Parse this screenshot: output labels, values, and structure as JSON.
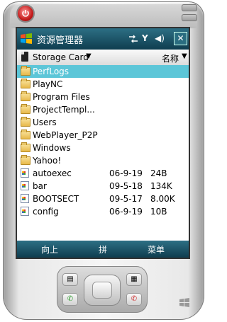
{
  "titlebar": {
    "app_title": "资源管理器",
    "close_label": "✕",
    "signal_label": "Y",
    "volume_label": "◀)"
  },
  "location": {
    "storage": "Storage Card",
    "sort": "名称"
  },
  "files": [
    {
      "name": "PerfLogs",
      "type": "folder",
      "date": "",
      "size": "",
      "selected": true
    },
    {
      "name": "PlayNC",
      "type": "folder",
      "date": "",
      "size": ""
    },
    {
      "name": "Program Files",
      "type": "folder",
      "date": "",
      "size": ""
    },
    {
      "name": "ProjectTempl...",
      "type": "folder",
      "date": "",
      "size": ""
    },
    {
      "name": "Users",
      "type": "folder",
      "date": "",
      "size": ""
    },
    {
      "name": "WebPlayer_P2P",
      "type": "folder",
      "date": "",
      "size": ""
    },
    {
      "name": "Windows",
      "type": "folder",
      "date": "",
      "size": ""
    },
    {
      "name": "Yahoo!",
      "type": "folder",
      "date": "",
      "size": ""
    },
    {
      "name": "autoexec",
      "type": "file",
      "date": "06-9-19",
      "size": "24B"
    },
    {
      "name": "bar",
      "type": "file",
      "date": "09-5-18",
      "size": "134K"
    },
    {
      "name": "BOOTSECT",
      "type": "file",
      "date": "09-5-17",
      "size": "8.00K"
    },
    {
      "name": "config",
      "type": "file",
      "date": "06-9-19",
      "size": "10B"
    }
  ],
  "softkeys": {
    "left": "向上",
    "center": "拼",
    "right": "菜单"
  },
  "colors": {
    "title_bar": "#1d5468",
    "selection": "#5cc6d8"
  }
}
